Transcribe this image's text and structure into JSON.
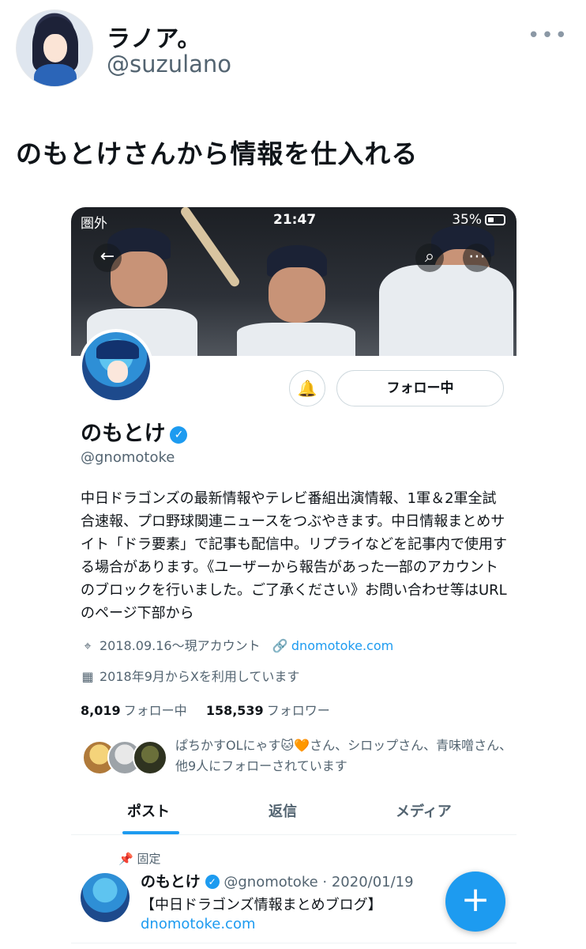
{
  "tweet": {
    "author_name": "ラノア。",
    "author_handle": "@suzulano",
    "more_icon": "more-horizontal-icon",
    "text": "のもとけさんから情報を仕入れる"
  },
  "screenshot": {
    "status_bar": {
      "carrier": "圏外",
      "time": "21:47",
      "battery": "35%"
    },
    "profile": {
      "name": "のもとけ",
      "handle": "@gnomotoke",
      "follow_button": "フォロー中",
      "bio": "中日ドラゴンズの最新情報やテレビ番組出演情報、1軍＆2軍全試合速報、プロ野球関連ニュースをつぶやきます。中日情報まとめサイト「ドラ要素」で記事も配信中。リプライなどを記事内で使用する場合があります。《ユーザーから報告があった一部のアカウントのブロックを行いました。ご了承ください》お問い合わせ等はURLのページ下部から",
      "location": "2018.09.16～現アカウント",
      "url": "dnomotoke.com",
      "joined": "2018年9月からXを利用しています",
      "following_count": "8,019",
      "following_label": "フォロー中",
      "followers_count": "158,539",
      "followers_label": "フォロワー",
      "followed_by": "ぱちかすOLにゃす🐱🧡さん、シロップさん、青味噌さん、他9人にフォローされています"
    },
    "tabs": [
      {
        "label": "ポスト",
        "active": true
      },
      {
        "label": "返信",
        "active": false
      },
      {
        "label": "メディア",
        "active": false
      }
    ],
    "pinned_post": {
      "pinned_label": "固定",
      "name": "のもとけ",
      "handle_date": "@gnomotoke · 2020/01/19",
      "line1": "【中日ドラゴンズ情報まとめブログ】",
      "line2": "dnomotoke.com"
    }
  },
  "colors": {
    "accent": "#1d9bf0",
    "text": "#0f1419",
    "secondary": "#536471"
  }
}
